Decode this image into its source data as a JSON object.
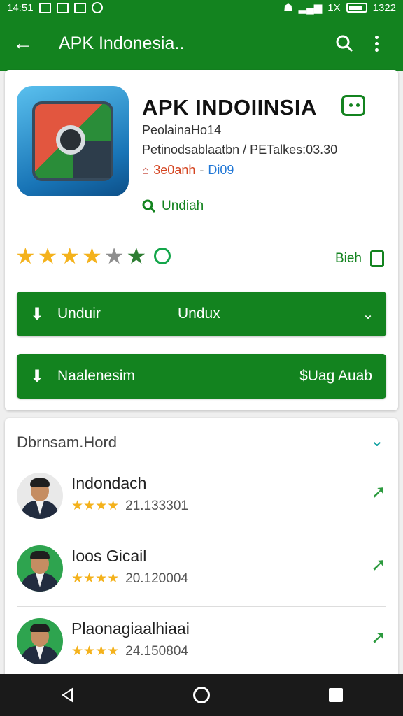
{
  "status": {
    "time": "14:51",
    "right_text": "1X",
    "battery_time": "1322"
  },
  "appbar": {
    "title": "APK Indonesia.."
  },
  "app": {
    "title": "APK INDOIINSIA",
    "line1": "PeolainaHo14",
    "line2": "Petinodsablaatbn / PETalkes:03.30",
    "tag_red": "3e0anh",
    "tag_blue": "Di09",
    "unduh_label": "Undiah"
  },
  "rating": {
    "stars": 4,
    "save_label": "Bieh"
  },
  "buttons": {
    "primary": {
      "label": "Unduir",
      "mid": "Undux"
    },
    "secondary": {
      "label": "Naalenesim",
      "right": "$Uag Auab"
    }
  },
  "reviews": {
    "title": "Dbrnsam.Hord",
    "items": [
      {
        "name": "Indondach",
        "value": "21.133301"
      },
      {
        "name": "Ioos Gicail",
        "value": "20.120004"
      },
      {
        "name": "Plaonagiaalhiaai",
        "value": "24.150804"
      }
    ]
  },
  "colors": {
    "primary": "#13831f",
    "star": "#f4b21c"
  }
}
